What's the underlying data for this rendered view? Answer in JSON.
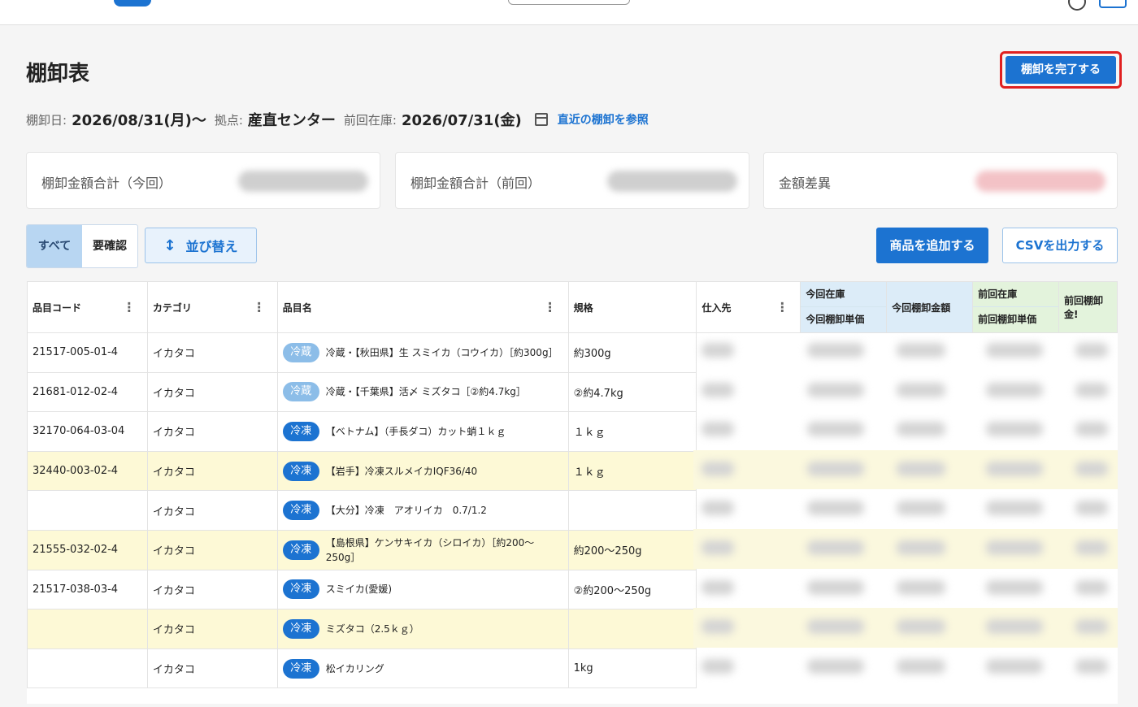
{
  "page": {
    "title": "棚卸表",
    "finish_label": "棚卸を完了する"
  },
  "meta": {
    "date_label": "棚卸日:",
    "date_value": "2026/08/31(月)〜",
    "base_label": "拠点:",
    "base_value": "産直センター",
    "prev_label": "前回在庫:",
    "prev_value": "2026/07/31(金)",
    "recent_link": "直近の棚卸を参照",
    "calendar_icon": "calendar-icon"
  },
  "summary": [
    {
      "label": "棚卸金額合計（今回）"
    },
    {
      "label": "棚卸金額合計（前回）"
    },
    {
      "label": "金額差異"
    }
  ],
  "filter": {
    "all": "すべて",
    "needs_check": "要確認",
    "sort": "並び替え",
    "add": "商品を追加する",
    "csv": "CSVを出力する"
  },
  "table": {
    "headers": {
      "code": "品目コード",
      "category": "カテゴリ",
      "name": "品目名",
      "spec": "規格",
      "supplier": "仕入先",
      "cur_stock": "今回在庫",
      "cur_unit": "今回棚卸単価",
      "cur_amount": "今回棚卸金額",
      "prev_stock": "前回在庫",
      "prev_unit": "前回棚卸単価",
      "prev_amount": "前回棚卸金!"
    },
    "rows": [
      {
        "code": "21517-005-01-4",
        "category": "イカタコ",
        "badge": "冷蔵",
        "name": "冷蔵・【秋田県】生 スミイカ（コウイカ）［約300g］",
        "spec": "約300g"
      },
      {
        "code": "21681-012-02-4",
        "category": "イカタコ",
        "badge": "冷蔵",
        "name": "冷蔵・【千葉県】活〆 ミズタコ［②約4.7kg］",
        "spec": "②約4.7kg"
      },
      {
        "code": "32170-064-03-04",
        "category": "イカタコ",
        "badge": "冷凍",
        "name": "【ベトナム】（手長ダコ）カット蛸１ｋｇ",
        "spec": "１ｋｇ"
      },
      {
        "code": "32440-003-02-4",
        "category": "イカタコ",
        "badge": "冷凍",
        "name": "【岩手】冷凍スルメイカIQF36/40",
        "spec": "１ｋｇ"
      },
      {
        "code": "",
        "category": "イカタコ",
        "badge": "冷凍",
        "name": "【大分】冷凍　アオリイカ　0.7/1.2",
        "spec": ""
      },
      {
        "code": "21555-032-02-4",
        "category": "イカタコ",
        "badge": "冷凍",
        "name": "【島根県】ケンサキイカ（シロイカ）［約200〜250g］",
        "spec": "約200〜250g"
      },
      {
        "code": "21517-038-03-4",
        "category": "イカタコ",
        "badge": "冷凍",
        "name": "スミイカ(愛媛)",
        "spec": "②約200〜250g"
      },
      {
        "code": "",
        "category": "イカタコ",
        "badge": "冷凍",
        "name": "ミズタコ（2.5ｋｇ）",
        "spec": ""
      },
      {
        "code": "",
        "category": "イカタコ",
        "badge": "冷凍",
        "name": "松イカリング",
        "spec": "1kg"
      }
    ]
  }
}
